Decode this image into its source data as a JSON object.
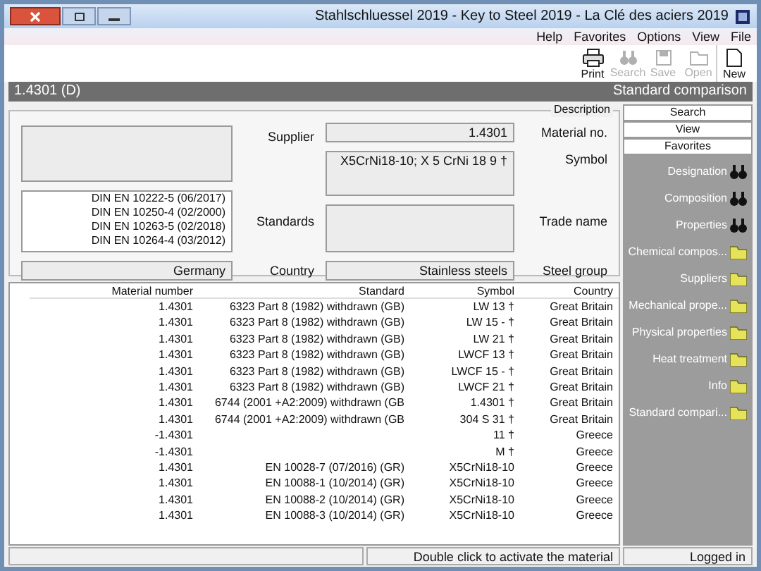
{
  "window": {
    "title": "Stahlschluessel 2019 - Key to Steel 2019 - La Clé des aciers 2019"
  },
  "menu": [
    "Help",
    "Favorites",
    "Options",
    "View",
    "File"
  ],
  "toolbar": [
    {
      "label": "Print",
      "kind": "print",
      "disabled": false
    },
    {
      "label": "Search",
      "kind": "search",
      "disabled": true
    },
    {
      "label": "Save",
      "kind": "save",
      "disabled": true
    },
    {
      "label": "Open",
      "kind": "open",
      "disabled": true
    },
    {
      "label": "New",
      "kind": "new",
      "disabled": false
    }
  ],
  "header": {
    "material": "1.4301 (D)",
    "title": "Standard comparison"
  },
  "description": {
    "legend": "Description",
    "material_no": {
      "label": "Material no.",
      "value": "1.4301"
    },
    "symbol": {
      "label": "Symbol",
      "value": "X5CrNi18-10; X 5 CrNi 18 9 †"
    },
    "trade_name": {
      "label": "Trade name"
    },
    "steel_group": {
      "label": "Steel group",
      "value": "Stainless steels"
    },
    "supplier": {
      "label": "Supplier"
    },
    "standards": {
      "label": "Standards",
      "items": [
        "DIN EN 10222-5 (06/2017)",
        "DIN EN 10250-4 (02/2000)",
        "DIN EN 10263-5 (02/2018)",
        "DIN EN 10264-4 (03/2012)"
      ]
    },
    "country": {
      "label": "Country",
      "value": "Germany"
    }
  },
  "table": {
    "columns": [
      "Material number",
      "Standard",
      "Symbol",
      "Country"
    ],
    "rows": [
      [
        "1.4301",
        "6323 Part 8 (1982) withdrawn (GB)",
        "LW 13 †",
        "Great Britain"
      ],
      [
        "1.4301",
        "6323 Part 8 (1982) withdrawn (GB)",
        "LW 15 - †",
        "Great Britain"
      ],
      [
        "1.4301",
        "6323 Part 8 (1982) withdrawn (GB)",
        "LW 21 †",
        "Great Britain"
      ],
      [
        "1.4301",
        "6323 Part 8 (1982) withdrawn (GB)",
        "LWCF 13 †",
        "Great Britain"
      ],
      [
        "1.4301",
        "6323 Part 8 (1982) withdrawn (GB)",
        "LWCF 15 - †",
        "Great Britain"
      ],
      [
        "1.4301",
        "6323 Part 8 (1982) withdrawn (GB)",
        "LWCF 21 †",
        "Great Britain"
      ],
      [
        "1.4301",
        "6744 (2001 +A2:2009) withdrawn (GB",
        "1.4301 †",
        "Great Britain"
      ],
      [
        "1.4301",
        "6744 (2001 +A2:2009) withdrawn (GB",
        "304 S 31 †",
        "Great Britain"
      ],
      [
        "-1.4301",
        null,
        "11 †",
        "Greece"
      ],
      [
        "-1.4301",
        null,
        "M †",
        "Greece"
      ],
      [
        "1.4301",
        "EN 10028-7 (07/2016) (GR)",
        "X5CrNi18-10",
        "Greece"
      ],
      [
        "1.4301",
        "EN 10088-1 (10/2014) (GR)",
        "X5CrNi18-10",
        "Greece"
      ],
      [
        "1.4301",
        "EN 10088-2 (10/2014) (GR)",
        "X5CrNi18-10",
        "Greece"
      ],
      [
        "1.4301",
        "EN 10088-3 (10/2014) (GR)",
        "X5CrNi18-10",
        "Greece"
      ]
    ]
  },
  "sidebar": {
    "buttons": [
      "Search",
      "View",
      "Favorites"
    ],
    "items": [
      {
        "label": "Designation",
        "kind": "search"
      },
      {
        "label": "Composition",
        "kind": "search"
      },
      {
        "label": "Properties",
        "kind": "search"
      },
      {
        "label": "Chemical compos...",
        "kind": "folder"
      },
      {
        "label": "Suppliers",
        "kind": "folder"
      },
      {
        "label": "Mechanical prope...",
        "kind": "folder"
      },
      {
        "label": "Physical properties",
        "kind": "folder"
      },
      {
        "label": "Heat treatment",
        "kind": "folder"
      },
      {
        "label": "Info",
        "kind": "folder"
      },
      {
        "label": "Standard compari...",
        "kind": "folder"
      }
    ]
  },
  "status_bar": {
    "hint": "Double click to activate the material",
    "user": "Logged in"
  }
}
